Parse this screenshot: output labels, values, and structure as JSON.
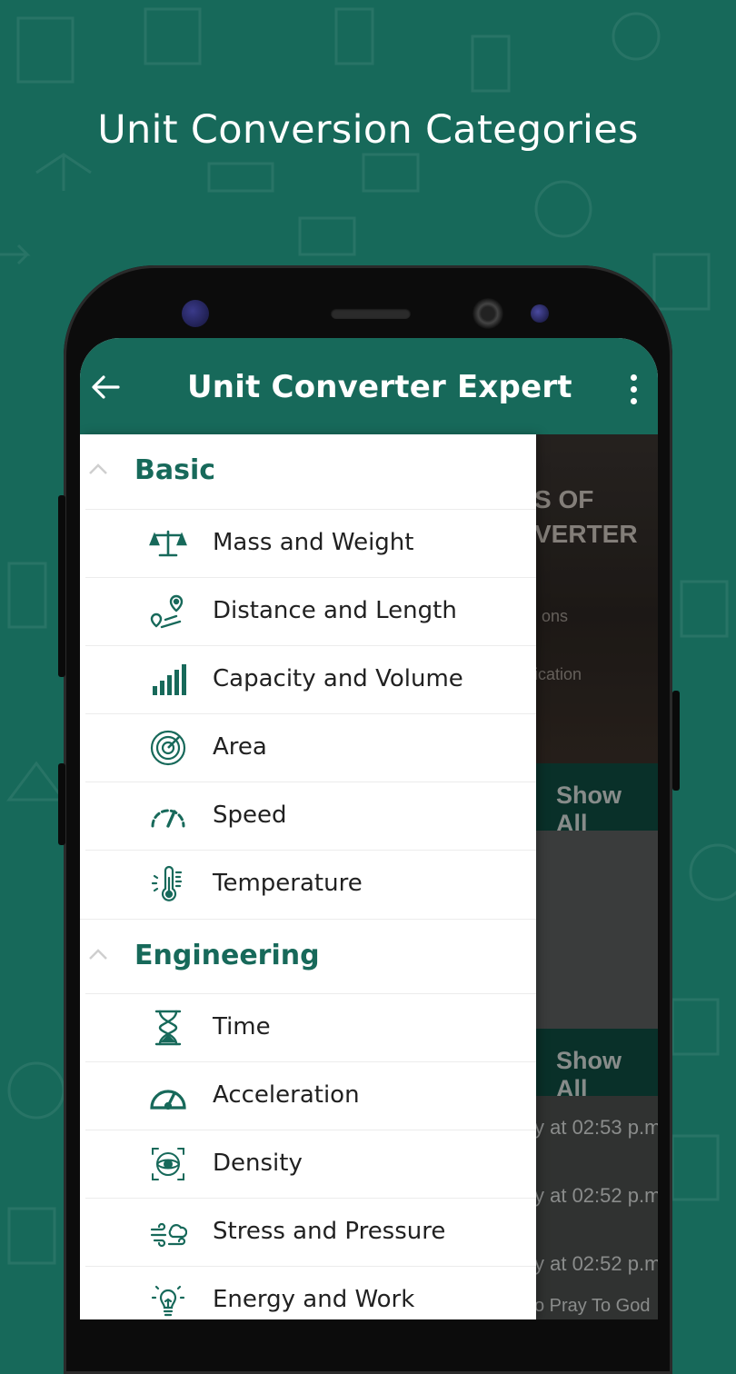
{
  "promo": {
    "title": "Unit Conversion Categories"
  },
  "appbar": {
    "title": "Unit Converter Expert",
    "back_icon": "arrow-left-icon",
    "menu_icon": "more-vert-icon"
  },
  "background": {
    "banner_line1": "S OF",
    "banner_line2": "VERTER",
    "banner_small1": "ons",
    "banner_small2": "ication",
    "show_all_1": "Show All",
    "show_all_2": "Show All",
    "history_rows": [
      "y at 02:53 p.m",
      "y at 02:52 p.m",
      "y at 02:52 p.m",
      "o Pray To God"
    ]
  },
  "drawer": {
    "sections": [
      {
        "label": "Basic",
        "items": [
          {
            "label": "Mass and Weight",
            "icon": "scale-icon"
          },
          {
            "label": "Distance and Length",
            "icon": "route-icon"
          },
          {
            "label": "Capacity and Volume",
            "icon": "bars-icon"
          },
          {
            "label": "Area",
            "icon": "radar-icon"
          },
          {
            "label": "Speed",
            "icon": "speedometer-icon"
          },
          {
            "label": "Temperature",
            "icon": "thermometer-icon"
          }
        ]
      },
      {
        "label": "Engineering",
        "items": [
          {
            "label": "Time",
            "icon": "hourglass-icon"
          },
          {
            "label": "Acceleration",
            "icon": "gauge-icon"
          },
          {
            "label": "Density",
            "icon": "density-icon"
          },
          {
            "label": "Stress and Pressure",
            "icon": "wind-cloud-icon"
          },
          {
            "label": "Energy and Work",
            "icon": "bulb-icon"
          }
        ]
      }
    ]
  },
  "colors": {
    "primary": "#17695a",
    "text": "#212121",
    "divider": "#ececec"
  }
}
